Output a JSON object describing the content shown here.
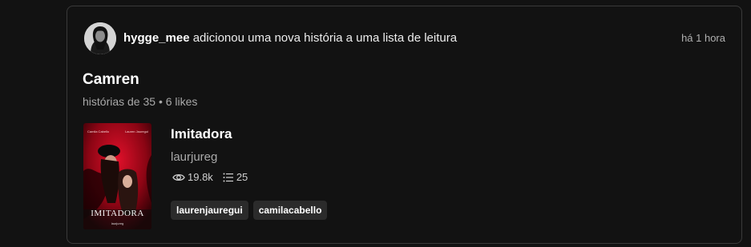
{
  "activity": {
    "username": "hygge_mee",
    "action_text": " adicionou uma nova história a uma lista de leitura",
    "time": "há 1 hora"
  },
  "reading_list": {
    "title": "Camren",
    "meta": "histórias de 35 • 6 likes"
  },
  "story": {
    "title": "Imitadora",
    "author": "laurjureg",
    "reads": "19.8k",
    "parts": "25",
    "cover": {
      "title_text": "IMITADORA",
      "top_left_text": "Camila Cabello",
      "top_right_text": "Lauren Jauregui",
      "bottom_text": "laurjureg"
    }
  },
  "tags": [
    "laurenjauregui",
    "camilacabello"
  ],
  "colors": {
    "background": "#121212",
    "card_border": "#3a3a3a",
    "tag_background": "#2b2b2b",
    "cover_red": "#b3081c"
  },
  "icons": {
    "reads": "eye-icon",
    "parts": "list-icon"
  }
}
